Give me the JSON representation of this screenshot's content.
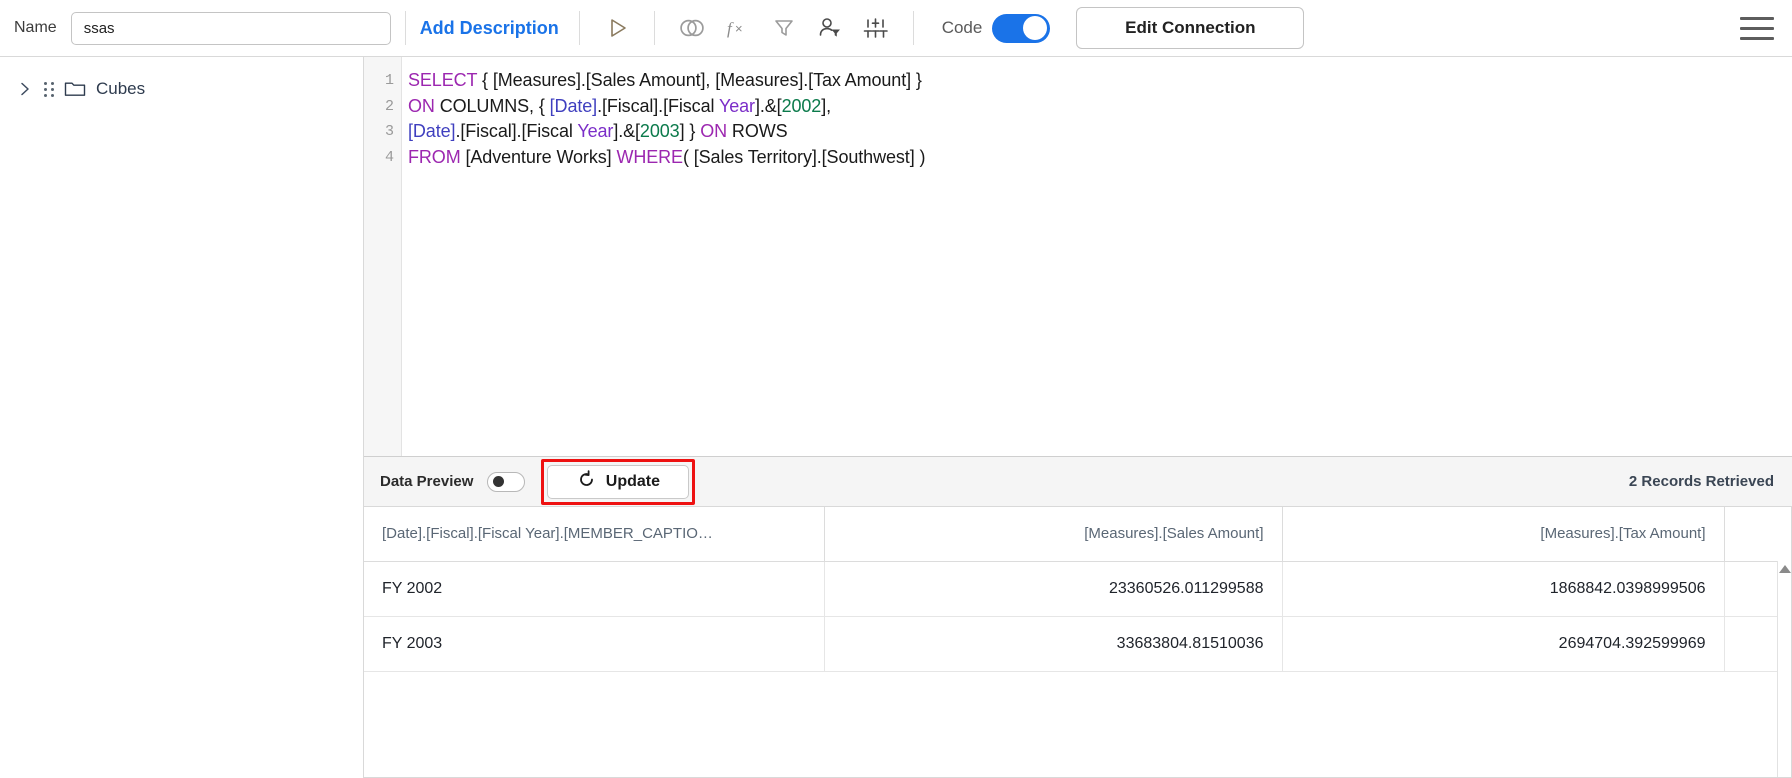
{
  "topbar": {
    "name_label": "Name",
    "name_value": "ssas",
    "name_placeholder": "Name",
    "add_description": "Add Description",
    "icons": [
      {
        "name": "run-icon",
        "title": "Run"
      },
      {
        "name": "join-icon",
        "title": "Join"
      },
      {
        "name": "formula-fx-icon",
        "title": "Formula"
      },
      {
        "name": "filter-icon",
        "title": "Filter"
      },
      {
        "name": "person-filter-icon",
        "title": "User Filter"
      },
      {
        "name": "settings-sliders-icon",
        "title": "Settings"
      }
    ],
    "code_label": "Code",
    "code_toggle_on": true,
    "edit_connection": "Edit Connection",
    "menu_icon": "hamburger-menu-icon",
    "accent_color": "#1a73e8"
  },
  "sidebar": {
    "items": [
      {
        "label": "Cubes",
        "icon": "folder-icon",
        "expanded": false
      }
    ]
  },
  "editor": {
    "language": "MDX",
    "lines": [
      {
        "number": "1",
        "tokens": [
          {
            "t": "SELECT",
            "c": "kw"
          },
          {
            "t": " { [Measures].[Sales Amount], [Measures].[Tax Amount] }",
            "c": "txt"
          }
        ]
      },
      {
        "number": "2",
        "tokens": [
          {
            "t": "ON",
            "c": "kw"
          },
          {
            "t": " COLUMNS, { ",
            "c": "txt"
          },
          {
            "t": "[Date]",
            "c": "id"
          },
          {
            "t": ".[Fiscal].[Fiscal ",
            "c": "txt"
          },
          {
            "t": "Year",
            "c": "prop"
          },
          {
            "t": "].&[",
            "c": "txt"
          },
          {
            "t": "2002",
            "c": "num"
          },
          {
            "t": "],",
            "c": "txt"
          }
        ]
      },
      {
        "number": "3",
        "tokens": [
          {
            "t": "[Date]",
            "c": "id"
          },
          {
            "t": ".[Fiscal].[Fiscal ",
            "c": "txt"
          },
          {
            "t": "Year",
            "c": "prop"
          },
          {
            "t": "].&[",
            "c": "txt"
          },
          {
            "t": "2003",
            "c": "num"
          },
          {
            "t": "] } ",
            "c": "txt"
          },
          {
            "t": "ON",
            "c": "kw"
          },
          {
            "t": " ROWS",
            "c": "txt"
          }
        ]
      },
      {
        "number": "4",
        "tokens": [
          {
            "t": "FROM",
            "c": "kw"
          },
          {
            "t": " [Adventure Works] ",
            "c": "txt"
          },
          {
            "t": "WHERE",
            "c": "kw"
          },
          {
            "t": "( [Sales Territory].[Southwest] )",
            "c": "txt"
          }
        ]
      }
    ]
  },
  "data_preview": {
    "label": "Data Preview",
    "toggle_on": false,
    "update_label": "Update",
    "update_icon": "refresh-icon",
    "highlight_color": "#ee1111",
    "records_retrieved": "2 Records Retrieved"
  },
  "results": {
    "columns": [
      "[Date].[Fiscal].[Fiscal Year].[MEMBER_CAPTIO…",
      "[Measures].[Sales Amount]",
      "[Measures].[Tax Amount]"
    ],
    "rows": [
      [
        "FY 2002",
        "23360526.011299588",
        "1868842.0398999506"
      ],
      [
        "FY 2003",
        "33683804.81510036",
        "2694704.392599969"
      ]
    ],
    "scrollbar": "vertical-scrollbar"
  }
}
